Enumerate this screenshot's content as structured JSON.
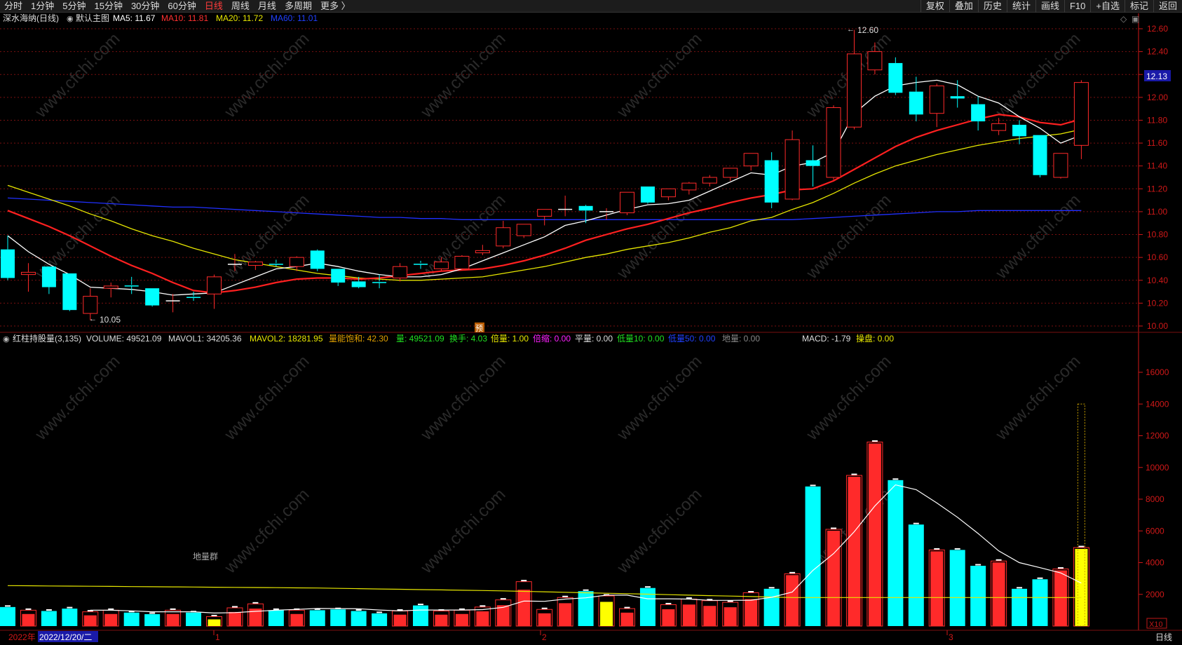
{
  "toolbar": {
    "periods": [
      "分时",
      "1分钟",
      "5分钟",
      "15分钟",
      "30分钟",
      "60分钟",
      "日线",
      "周线",
      "月线",
      "多周期",
      "更多 〉"
    ],
    "active_period": "日线",
    "tools": [
      "复权",
      "叠加",
      "历史",
      "统计",
      "画线",
      "F10",
      "+自选",
      "标记",
      "返回"
    ]
  },
  "price_panel": {
    "stock_label": "深水海纳(日线)",
    "main_indicator": "默认主图",
    "ma5": "MA5: 11.67",
    "ma10": "MA10: 11.81",
    "ma20": "MA20: 11.72",
    "ma60": "MA60: 11.01",
    "high_marker": "12.60",
    "low_marker": "10.05",
    "current_price_tag": "12.13",
    "forecast_badge": "预",
    "y_ticks": [
      "12.60",
      "12.40",
      "12.20",
      "12.00",
      "11.80",
      "11.60",
      "11.40",
      "11.20",
      "11.00",
      "10.80",
      "10.60",
      "10.40",
      "10.20",
      "10.00"
    ]
  },
  "volume_panel": {
    "indicator_name": "红柱持股量(3,135)",
    "volume": "VOLUME: 49521.09",
    "mavol1": "MAVOL1: 34205.36",
    "mavol2": "MAVOL2: 18281.95",
    "saturation": "量能饱和: 42.30",
    "liang": "量: 49521.09",
    "turnover": "换手: 4.03",
    "multiple": "倍量: 1.00",
    "shrink": "倍缩: 0.00",
    "flat": "平量: 0.00",
    "low10": "低量10: 0.00",
    "low50": "低量50: 0.00",
    "ground": "地量: 0.00",
    "macd": "MACD: -1.79",
    "operate": "操盘: 0.00",
    "ground_group_label": "地量群",
    "y_ticks": [
      "16000",
      "14000",
      "12000",
      "10000",
      "8000",
      "6000",
      "4000",
      "2000"
    ],
    "scale_badge": "X10"
  },
  "date_axis": {
    "year_label": "2022年",
    "cursor_date": "2022/12/20/二",
    "month_marks": [
      "1",
      "2",
      "3"
    ],
    "corner_label": "日线"
  },
  "watermark": "www.cfchi.com",
  "colors": {
    "up": "#ff2a2a",
    "down": "#00ffff",
    "ma5": "#ffffff",
    "ma10": "#ff2020",
    "ma20": "#e6e600",
    "ma60": "#2030ff",
    "grid": "#7a1010",
    "axis_text": "#d01818"
  },
  "chart_data": {
    "type": "candlestick",
    "price_range": [
      9.96,
      12.66
    ],
    "candles": [
      {
        "o": 10.67,
        "h": 10.79,
        "c": 10.42,
        "l": 10.4
      },
      {
        "o": 10.45,
        "h": 10.55,
        "c": 10.47,
        "l": 10.3
      },
      {
        "o": 10.52,
        "h": 10.52,
        "c": 10.34,
        "l": 10.28
      },
      {
        "o": 10.46,
        "h": 10.46,
        "c": 10.14,
        "l": 10.13
      },
      {
        "o": 10.11,
        "h": 10.33,
        "c": 10.26,
        "l": 10.05
      },
      {
        "o": 10.33,
        "h": 10.38,
        "c": 10.35,
        "l": 10.25
      },
      {
        "o": 10.36,
        "h": 10.43,
        "c": 10.35,
        "l": 10.28
      },
      {
        "o": 10.33,
        "h": 10.33,
        "c": 10.18,
        "l": 10.17
      },
      {
        "o": 10.22,
        "h": 10.28,
        "c": 10.22,
        "l": 10.12
      },
      {
        "o": 10.26,
        "h": 10.3,
        "c": 10.25,
        "l": 10.22
      },
      {
        "o": 10.28,
        "h": 10.45,
        "c": 10.43,
        "l": 10.15
      },
      {
        "o": 10.54,
        "h": 10.63,
        "c": 10.54,
        "l": 10.48
      },
      {
        "o": 10.53,
        "h": 10.57,
        "c": 10.56,
        "l": 10.49
      },
      {
        "o": 10.55,
        "h": 10.58,
        "c": 10.54,
        "l": 10.52
      },
      {
        "o": 10.52,
        "h": 10.61,
        "c": 10.6,
        "l": 10.48
      },
      {
        "o": 10.66,
        "h": 10.67,
        "c": 10.5,
        "l": 10.48
      },
      {
        "o": 10.5,
        "h": 10.5,
        "c": 10.38,
        "l": 10.35
      },
      {
        "o": 10.39,
        "h": 10.43,
        "c": 10.34,
        "l": 10.33
      },
      {
        "o": 10.39,
        "h": 10.45,
        "c": 10.38,
        "l": 10.33
      },
      {
        "o": 10.42,
        "h": 10.55,
        "c": 10.52,
        "l": 10.39
      },
      {
        "o": 10.55,
        "h": 10.57,
        "c": 10.54,
        "l": 10.5
      },
      {
        "o": 10.5,
        "h": 10.6,
        "c": 10.56,
        "l": 10.48
      },
      {
        "o": 10.5,
        "h": 10.62,
        "c": 10.61,
        "l": 10.49
      },
      {
        "o": 10.64,
        "h": 10.71,
        "c": 10.66,
        "l": 10.62
      },
      {
        "o": 10.7,
        "h": 10.92,
        "c": 10.86,
        "l": 10.68
      },
      {
        "o": 10.79,
        "h": 10.89,
        "c": 10.89,
        "l": 10.77
      },
      {
        "o": 10.96,
        "h": 11.0,
        "c": 11.02,
        "l": 10.88
      },
      {
        "o": 11.02,
        "h": 11.14,
        "c": 11.02,
        "l": 10.96
      },
      {
        "o": 11.05,
        "h": 11.06,
        "c": 11.01,
        "l": 10.9
      },
      {
        "o": 10.99,
        "h": 11.03,
        "c": 11.0,
        "l": 10.93
      },
      {
        "o": 10.99,
        "h": 11.17,
        "c": 11.17,
        "l": 10.97
      },
      {
        "o": 11.22,
        "h": 11.22,
        "c": 11.08,
        "l": 11.07
      },
      {
        "o": 11.13,
        "h": 11.2,
        "c": 11.2,
        "l": 11.1
      },
      {
        "o": 11.19,
        "h": 11.26,
        "c": 11.25,
        "l": 11.15
      },
      {
        "o": 11.25,
        "h": 11.32,
        "c": 11.3,
        "l": 11.22
      },
      {
        "o": 11.3,
        "h": 11.38,
        "c": 11.38,
        "l": 11.27
      },
      {
        "o": 11.4,
        "h": 11.5,
        "c": 11.51,
        "l": 11.36
      },
      {
        "o": 11.45,
        "h": 11.52,
        "c": 11.08,
        "l": 11.03
      },
      {
        "o": 11.11,
        "h": 11.71,
        "c": 11.63,
        "l": 11.1
      },
      {
        "o": 11.45,
        "h": 11.58,
        "c": 11.4,
        "l": 11.22
      },
      {
        "o": 11.3,
        "h": 11.93,
        "c": 11.91,
        "l": 11.28
      },
      {
        "o": 11.74,
        "h": 12.59,
        "c": 12.38,
        "l": 11.72
      },
      {
        "o": 12.24,
        "h": 12.48,
        "c": 12.4,
        "l": 12.2
      },
      {
        "o": 12.3,
        "h": 12.35,
        "c": 12.04,
        "l": 12.02
      },
      {
        "o": 12.05,
        "h": 12.18,
        "c": 11.85,
        "l": 11.79
      },
      {
        "o": 11.86,
        "h": 12.12,
        "c": 12.1,
        "l": 11.74
      },
      {
        "o": 12.01,
        "h": 12.15,
        "c": 11.99,
        "l": 11.91
      },
      {
        "o": 11.94,
        "h": 12.01,
        "c": 11.79,
        "l": 11.71
      },
      {
        "o": 11.71,
        "h": 11.82,
        "c": 11.77,
        "l": 11.67
      },
      {
        "o": 11.76,
        "h": 11.8,
        "c": 11.66,
        "l": 11.59
      },
      {
        "o": 11.67,
        "h": 11.67,
        "c": 11.32,
        "l": 11.3
      },
      {
        "o": 11.3,
        "h": 11.51,
        "c": 11.51,
        "l": 11.29
      },
      {
        "o": 11.58,
        "h": 12.15,
        "c": 12.13,
        "l": 11.46
      }
    ],
    "ma5": [
      10.79,
      10.65,
      10.54,
      10.45,
      10.34,
      10.33,
      10.32,
      10.3,
      10.27,
      10.28,
      10.29,
      10.36,
      10.43,
      10.5,
      10.52,
      10.55,
      10.52,
      10.48,
      10.45,
      10.43,
      10.43,
      10.45,
      10.5,
      10.57,
      10.64,
      10.71,
      10.78,
      10.88,
      10.92,
      10.97,
      11.02,
      11.06,
      11.07,
      11.1,
      11.18,
      11.26,
      11.34,
      11.32,
      11.4,
      11.43,
      11.52,
      11.86,
      12.01,
      12.1,
      12.13,
      12.15,
      12.11,
      12.01,
      11.95,
      11.83,
      11.73,
      11.6,
      11.67
    ],
    "ma10": [
      11.01,
      10.94,
      10.87,
      10.79,
      10.7,
      10.61,
      10.53,
      10.46,
      10.38,
      10.31,
      10.29,
      10.31,
      10.34,
      10.38,
      10.41,
      10.42,
      10.42,
      10.41,
      10.42,
      10.44,
      10.46,
      10.48,
      10.49,
      10.5,
      10.53,
      10.57,
      10.62,
      10.68,
      10.75,
      10.8,
      10.85,
      10.89,
      10.94,
      10.99,
      11.03,
      11.08,
      11.12,
      11.15,
      11.19,
      11.2,
      11.27,
      11.37,
      11.47,
      11.57,
      11.65,
      11.71,
      11.76,
      11.81,
      11.85,
      11.83,
      11.78,
      11.76,
      11.81
    ],
    "ma20": [
      11.23,
      11.17,
      11.11,
      11.05,
      10.98,
      10.92,
      10.85,
      10.79,
      10.74,
      10.68,
      10.63,
      10.58,
      10.55,
      10.52,
      10.49,
      10.46,
      10.44,
      10.42,
      10.41,
      10.4,
      10.4,
      10.41,
      10.42,
      10.43,
      10.46,
      10.49,
      10.52,
      10.56,
      10.6,
      10.63,
      10.67,
      10.7,
      10.73,
      10.77,
      10.82,
      10.86,
      10.92,
      10.95,
      11.02,
      11.08,
      11.16,
      11.25,
      11.33,
      11.4,
      11.45,
      11.5,
      11.54,
      11.58,
      11.61,
      11.64,
      11.66,
      11.68,
      11.72
    ],
    "ma60": [
      11.12,
      11.11,
      11.1,
      11.09,
      11.08,
      11.07,
      11.06,
      11.05,
      11.04,
      11.04,
      11.03,
      11.02,
      11.01,
      11.0,
      10.99,
      10.98,
      10.97,
      10.96,
      10.95,
      10.95,
      10.94,
      10.94,
      10.93,
      10.93,
      10.93,
      10.93,
      10.93,
      10.93,
      10.93,
      10.93,
      10.93,
      10.93,
      10.93,
      10.93,
      10.93,
      10.93,
      10.93,
      10.93,
      10.93,
      10.94,
      10.95,
      10.96,
      10.97,
      10.98,
      10.99,
      11.0,
      11.0,
      11.01,
      11.01,
      11.01,
      11.01,
      11.01,
      11.01
    ],
    "volume_range": [
      0,
      18000
    ],
    "volume": [
      1200,
      1000,
      950,
      1100,
      900,
      1000,
      850,
      750,
      1000,
      850,
      600,
      1150,
      1400,
      1000,
      1000,
      1000,
      1050,
      950,
      800,
      950,
      1300,
      950,
      1000,
      1200,
      1650,
      2800,
      1050,
      1800,
      2200,
      1900,
      1100,
      2400,
      1350,
      1700,
      1600,
      1500,
      2100,
      2350,
      3300,
      8800,
      6100,
      9500,
      11600,
      9200,
      6400,
      4800,
      4800,
      3800,
      4100,
      2350,
      2950,
      3600,
      4950
    ],
    "volume_ma": [
      null,
      null,
      null,
      null,
      1000,
      1000,
      960,
      900,
      900,
      900,
      820,
      850,
      930,
      1000,
      1050,
      1110,
      1100,
      1090,
      1010,
      960,
      1010,
      1010,
      1010,
      1040,
      1180,
      1580,
      1560,
      1700,
      1780,
      1950,
      1950,
      1720,
      1720,
      1700,
      1620,
      1620,
      1630,
      1810,
      2150,
      3510,
      4570,
      5950,
      7570,
      8900,
      8600,
      7760,
      6860,
      5840,
      4740,
      4000,
      3680,
      3350,
      2710
    ],
    "volume_ma2": [
      2550,
      2540,
      2530,
      2520,
      2510,
      2500,
      2490,
      2480,
      2470,
      2460,
      2450,
      2440,
      2430,
      2420,
      2410,
      2400,
      2380,
      2360,
      2340,
      2320,
      2300,
      2280,
      2260,
      2240,
      2220,
      2190,
      2160,
      2130,
      2100,
      2070,
      2040,
      2010,
      1980,
      1950,
      1920,
      1890,
      1860,
      1830,
      1800,
      1800,
      1800,
      1800,
      1800,
      1800,
      1800,
      1800,
      1800,
      1800,
      1800,
      1800,
      1800,
      1800,
      1800
    ]
  }
}
